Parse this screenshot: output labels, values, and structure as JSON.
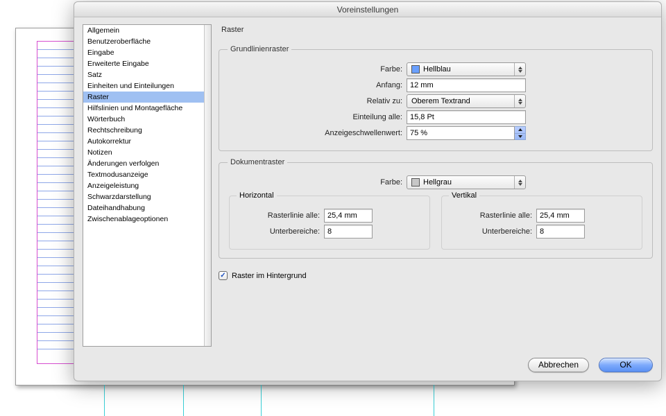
{
  "window": {
    "title": "Voreinstellungen"
  },
  "sidebar": {
    "items": [
      "Allgemein",
      "Benutzeroberfläche",
      "Eingabe",
      "Erweiterte Eingabe",
      "Satz",
      "Einheiten und Einteilungen",
      "Raster",
      "Hilfslinien und Montagefläche",
      "Wörterbuch",
      "Rechtschreibung",
      "Autokorrektur",
      "Notizen",
      "Änderungen verfolgen",
      "Textmodusanzeige",
      "Anzeigeleistung",
      "Schwarzdarstellung",
      "Dateihandhabung",
      "Zwischenablageoptionen"
    ],
    "selected_index": 6
  },
  "panel": {
    "title": "Raster",
    "baseline_grid": {
      "legend": "Grundlinienraster",
      "labels": {
        "color": "Farbe:",
        "start": "Anfang:",
        "relative": "Relativ zu:",
        "increment": "Einteilung alle:",
        "threshold": "Anzeigeschwellenwert:"
      },
      "values": {
        "color_name": "Hellblau",
        "color_hex": "#6aa0ff",
        "start": "12 mm",
        "relative": "Oberem Textrand",
        "increment": "15,8 Pt",
        "threshold": "75 %"
      }
    },
    "document_grid": {
      "legend": "Dokumentraster",
      "labels": {
        "color": "Farbe:",
        "horizontal": "Horizontal",
        "vertical": "Vertikal",
        "gridline": "Rasterlinie alle:",
        "subdivisions": "Unterbereiche:"
      },
      "values": {
        "color_name": "Hellgrau",
        "color_hex": "#c7c7c7",
        "horizontal": {
          "gridline": "25,4 mm",
          "subdivisions": "8"
        },
        "vertical": {
          "gridline": "25,4 mm",
          "subdivisions": "8"
        }
      }
    },
    "grids_in_back": {
      "label": "Raster im Hintergrund",
      "checked": true
    }
  },
  "footer": {
    "cancel": "Abbrechen",
    "ok": "OK"
  }
}
